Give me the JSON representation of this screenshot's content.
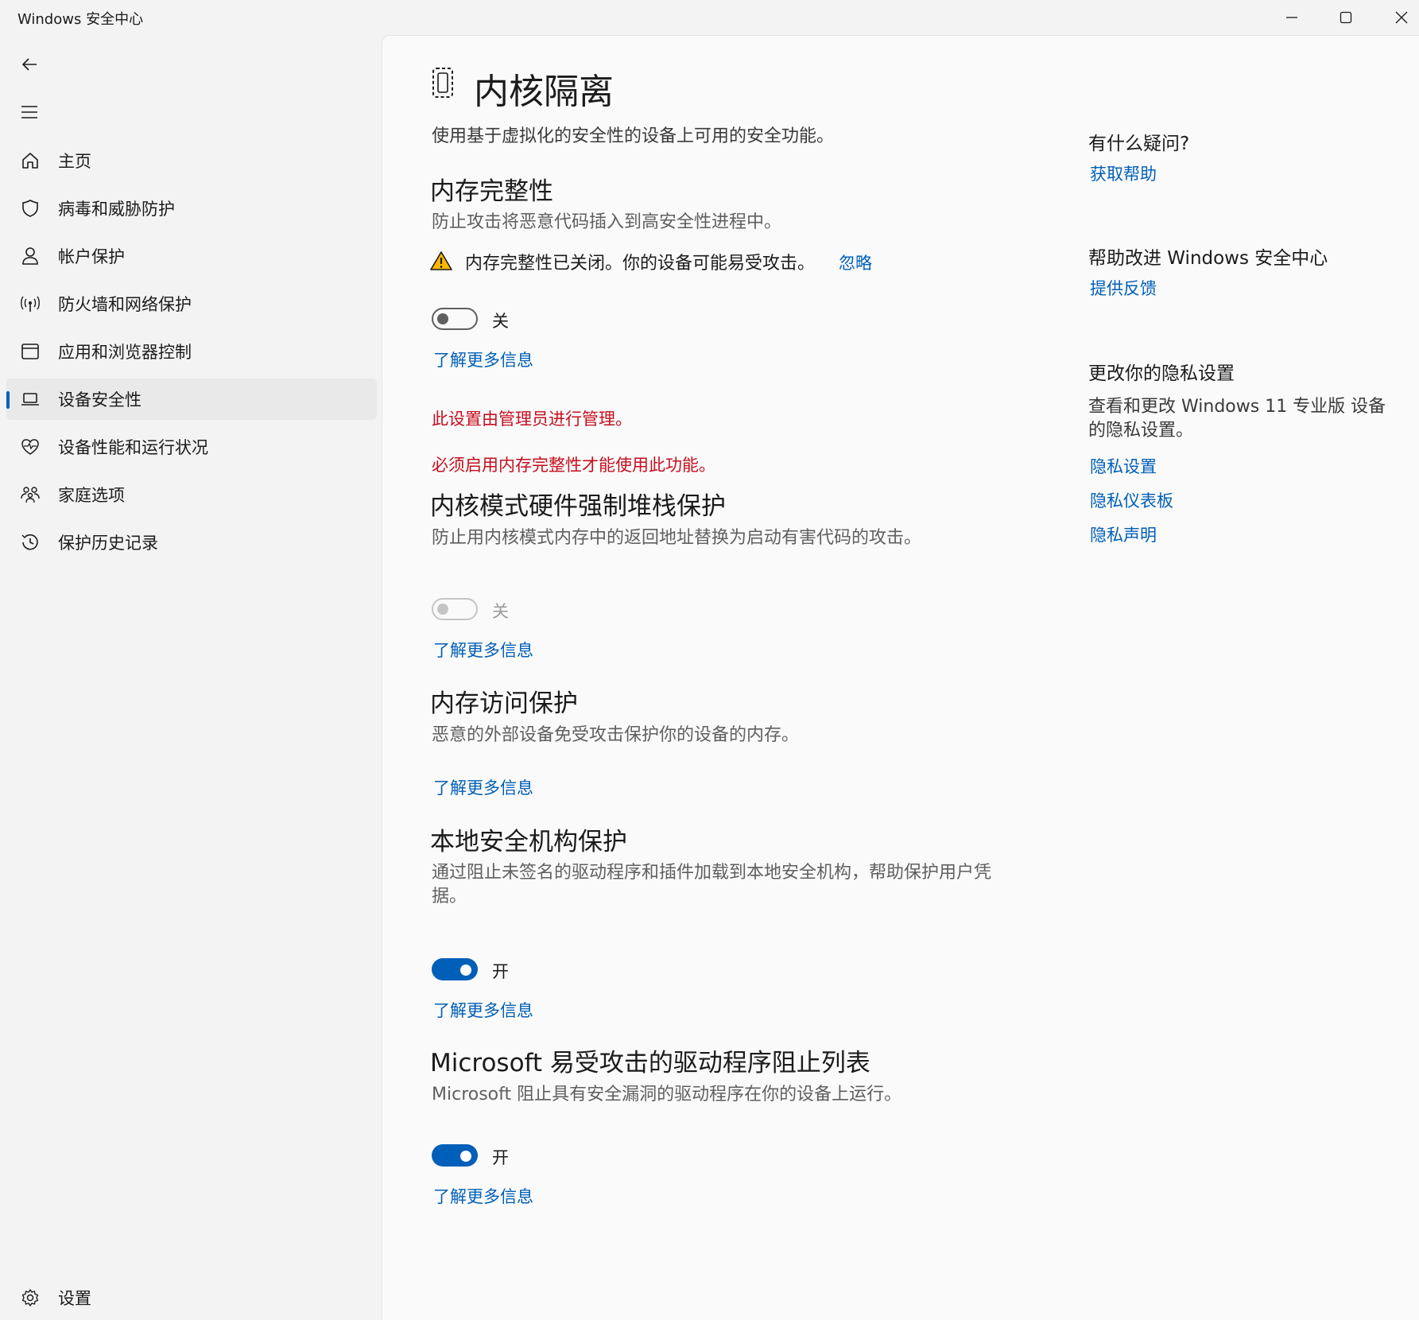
{
  "window": {
    "title": "Windows 安全中心"
  },
  "sidebar": {
    "items": [
      {
        "label": "主页",
        "icon": "home-icon"
      },
      {
        "label": "病毒和威胁防护",
        "icon": "shield-icon"
      },
      {
        "label": "帐户保护",
        "icon": "person-icon"
      },
      {
        "label": "防火墙和网络保护",
        "icon": "wifi-antenna-icon"
      },
      {
        "label": "应用和浏览器控制",
        "icon": "app-window-icon"
      },
      {
        "label": "设备安全性",
        "icon": "laptop-icon",
        "selected": true
      },
      {
        "label": "设备性能和运行状况",
        "icon": "heart-pulse-icon"
      },
      {
        "label": "家庭选项",
        "icon": "family-icon"
      },
      {
        "label": "保护历史记录",
        "icon": "history-icon"
      }
    ],
    "settings_label": "设置"
  },
  "page": {
    "title": "内核隔离",
    "description": "使用基于虚拟化的安全性的设备上可用的安全功能。"
  },
  "sections": {
    "memory_integrity": {
      "title": "内存完整性",
      "description": "防止攻击将恶意代码插入到高安全性进程中。",
      "warning": "内存完整性已关闭。你的设备可能易受攻击。",
      "dismiss": "忽略",
      "toggle_state": "关",
      "learn_more": "了解更多信息",
      "admin_notice": "此设置由管理员进行管理。",
      "requirement_notice": "必须启用内存完整性才能使用此功能。"
    },
    "kernel_stack": {
      "title": "内核模式硬件强制堆栈保护",
      "description": "防止用内核模式内存中的返回地址替换为启动有害代码的攻击。",
      "toggle_state": "关",
      "learn_more": "了解更多信息"
    },
    "memory_access": {
      "title": "内存访问保护",
      "description": "恶意的外部设备免受攻击保护你的设备的内存。",
      "learn_more": "了解更多信息"
    },
    "lsa": {
      "title": "本地安全机构保护",
      "description_line1": "通过阻止未签名的驱动程序和插件加载到本地安全机构，帮助保护用户凭",
      "description_line2": "据。",
      "toggle_state": "开",
      "learn_more": "了解更多信息"
    },
    "driver_blocklist": {
      "title": "Microsoft 易受攻击的驱动程序阻止列表",
      "description": "Microsoft 阻止具有安全漏洞的驱动程序在你的设备上运行。",
      "toggle_state": "开",
      "learn_more": "了解更多信息"
    }
  },
  "right_panel": {
    "question_title": "有什么疑问?",
    "get_help": "获取帮助",
    "improve_title": "帮助改进 Windows 安全中心",
    "feedback": "提供反馈",
    "privacy_title": "更改你的隐私设置",
    "privacy_desc": "查看和更改 Windows 11 专业版 设备的隐私设置。",
    "privacy_settings": "隐私设置",
    "privacy_dashboard": "隐私仪表板",
    "privacy_statement": "隐私声明"
  },
  "colors": {
    "accent": "#005fb8",
    "warning": "#ffb900",
    "error": "#c50f1f"
  }
}
